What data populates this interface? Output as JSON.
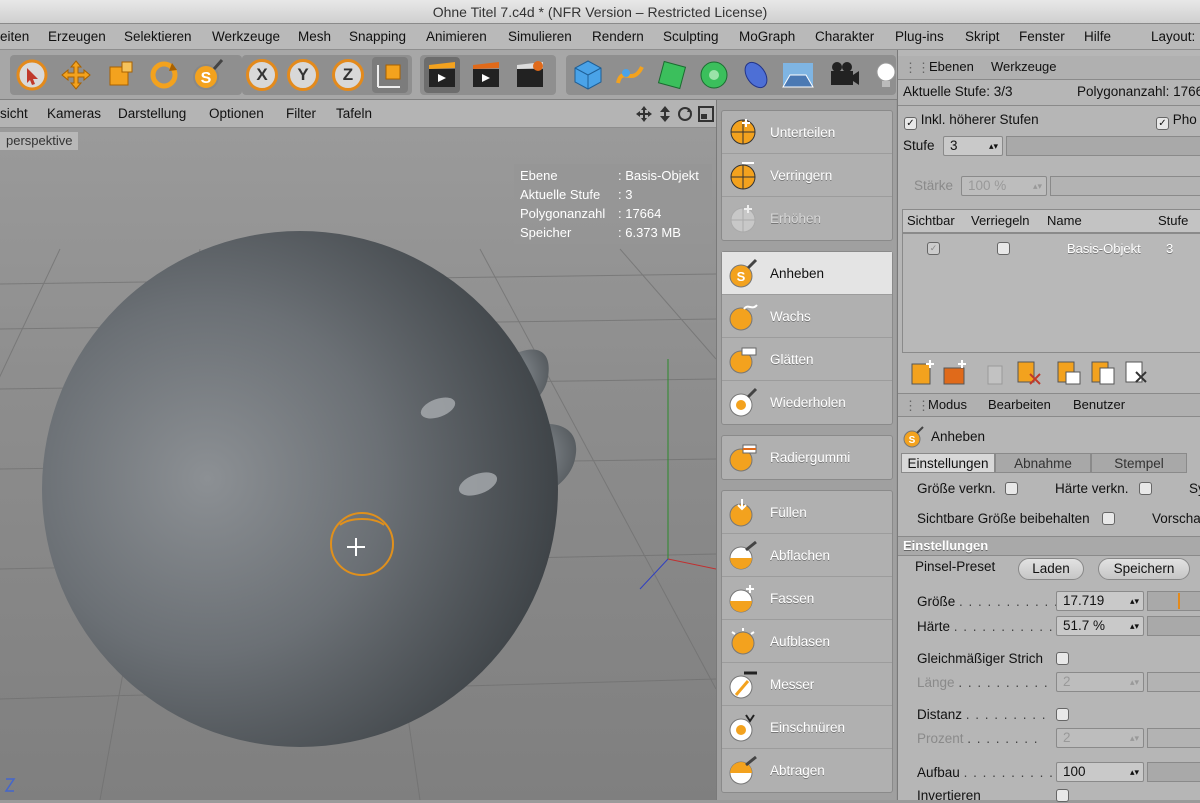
{
  "window": {
    "title": "Ohne Titel 7.c4d * (NFR Version – Restricted License)"
  },
  "menubar": {
    "items": [
      "eiten",
      "Erzeugen",
      "Selektieren",
      "Werkzeuge",
      "Mesh",
      "Snapping",
      "Animieren",
      "Simulieren",
      "Rendern",
      "Sculpting",
      "MoGraph",
      "Charakter",
      "Plug-ins",
      "Skript",
      "Fenster",
      "Hilfe",
      "Layout:"
    ]
  },
  "toolbar": {
    "axis_x": "X",
    "axis_y": "Y",
    "axis_z": "Z",
    "brush_letter": "S"
  },
  "viewport": {
    "menu": [
      "sicht",
      "Kameras",
      "Darstellung",
      "Optionen",
      "Filter",
      "Tafeln"
    ],
    "label": "perspektive",
    "hud": [
      {
        "k": "Ebene",
        "v": ": Basis-Objekt"
      },
      {
        "k": "Aktuelle Stufe",
        "v": ": 3"
      },
      {
        "k": "Polygonanzahl",
        "v": ": 17664"
      },
      {
        "k": "Speicher",
        "v": ": 6.373 MB"
      }
    ]
  },
  "tools": {
    "subdivide": [
      "Unterteilen",
      "Verringern",
      "Erhöhen"
    ],
    "sculpt1": [
      "Anheben",
      "Wachs",
      "Glätten",
      "Wiederholen"
    ],
    "eraser": "Radiergummi",
    "sculpt2": [
      "Füllen",
      "Abflachen",
      "Fassen",
      "Aufblasen",
      "Messer",
      "Einschnüren",
      "Abtragen"
    ]
  },
  "layers_panel": {
    "tabs": [
      "Ebenen",
      "Werkzeuge"
    ],
    "current_level_label": "Aktuelle Stufe: 3/3",
    "polycount_label": "Polygonanzahl: 1766",
    "incl_higher": "Inkl. höherer Stufen",
    "phong_cut": "Pho",
    "stufe_label": "Stufe",
    "stufe_value": "3",
    "staerke_label": "Stärke",
    "staerke_value": "100 %",
    "columns": [
      "Sichtbar",
      "Verriegeln",
      "Name",
      "Stufe"
    ],
    "row": {
      "name": "Basis-Objekt",
      "stufe": "3"
    }
  },
  "attr_panel": {
    "menu": [
      "Modus",
      "Bearbeiten",
      "Benutzer"
    ],
    "tool_name": "Anheben",
    "tabs": [
      "Einstellungen",
      "Abnahme",
      "Stempel"
    ],
    "groesse_verkn": "Größe verkn.",
    "haerte_verkn": "Härte verkn.",
    "sy_cut": "Sy",
    "sichtbare_groesse": "Sichtbare Größe beibehalten",
    "vorschau_cut": "Vorscha",
    "section": "Einstellungen",
    "preset_label": "Pinsel-Preset",
    "laden": "Laden",
    "speichern": "Speichern",
    "groesse_label": "Größe",
    "groesse_value": "17.719",
    "haerte_label": "Härte",
    "haerte_value": "51.7 %",
    "gleich_label": "Gleichmäßiger Strich",
    "laenge_label": "Länge",
    "laenge_value": "2",
    "distanz_label": "Distanz",
    "prozent_label": "Prozent",
    "prozent_value": "2",
    "aufbau_label": "Aufbau",
    "aufbau_value": "100",
    "invertieren_label": "Invertieren"
  }
}
